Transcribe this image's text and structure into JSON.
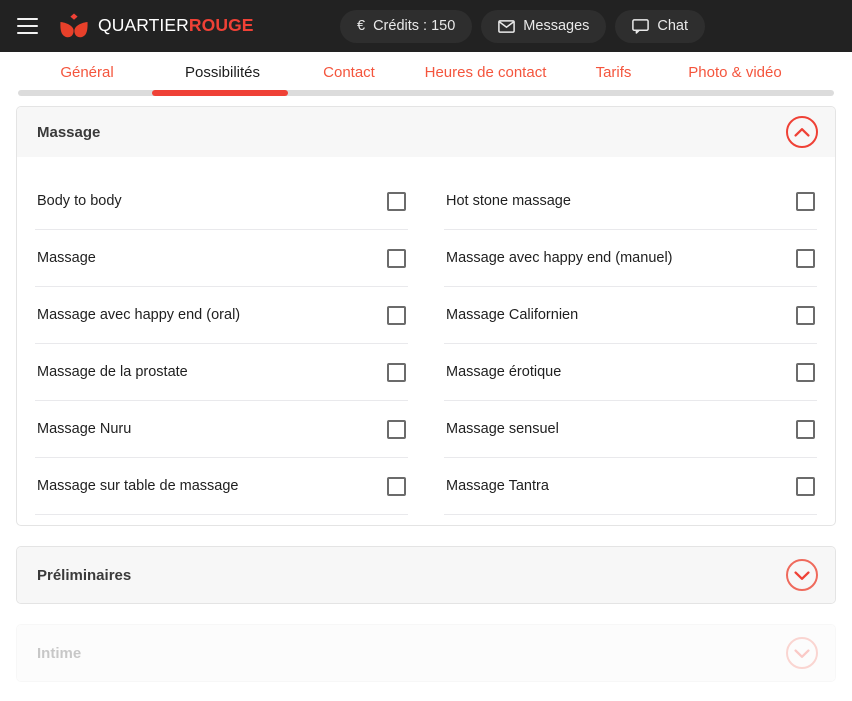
{
  "topbar": {
    "menu_icon": "hamburger-icon",
    "brand": {
      "part1": "QUARTIER",
      "part2": "ROUGE"
    },
    "credits": {
      "icon": "euro-icon",
      "label": "Crédits : 150"
    },
    "messages": {
      "icon": "envelope-icon",
      "label": "Messages"
    },
    "chat": {
      "icon": "chat-bubble-icon",
      "label": "Chat"
    }
  },
  "tabs": {
    "items": [
      {
        "label": "Général",
        "active": false
      },
      {
        "label": "Possibilités",
        "active": true
      },
      {
        "label": "Contact",
        "active": false
      },
      {
        "label": "Heures de contact",
        "active": false
      },
      {
        "label": "Tarifs",
        "active": false
      },
      {
        "label": "Photo & vidéo",
        "active": false
      }
    ]
  },
  "sections": [
    {
      "title": "Massage",
      "expanded": true,
      "toggle_icon": "chevron-up-icon",
      "options_left": [
        {
          "label": "Body to body",
          "checked": false
        },
        {
          "label": "Massage",
          "checked": false
        },
        {
          "label": "Massage avec happy end (oral)",
          "checked": false
        },
        {
          "label": "Massage de la prostate",
          "checked": false
        },
        {
          "label": "Massage Nuru",
          "checked": false
        },
        {
          "label": "Massage sur table de massage",
          "checked": false
        }
      ],
      "options_right": [
        {
          "label": "Hot stone massage",
          "checked": false
        },
        {
          "label": "Massage avec happy end (manuel)",
          "checked": false
        },
        {
          "label": "Massage Californien",
          "checked": false
        },
        {
          "label": "Massage érotique",
          "checked": false
        },
        {
          "label": "Massage sensuel",
          "checked": false
        },
        {
          "label": "Massage Tantra",
          "checked": false
        }
      ]
    },
    {
      "title": "Préliminaires",
      "expanded": false,
      "toggle_icon": "chevron-down-icon"
    },
    {
      "title": "Intime",
      "expanded": false,
      "toggle_icon": "chevron-down-icon"
    }
  ],
  "colors": {
    "brand_red": "#ef4136",
    "topbar_bg": "#222222",
    "section_header_bg": "#f7f7f7",
    "tab_track": "#dcdcdc"
  }
}
